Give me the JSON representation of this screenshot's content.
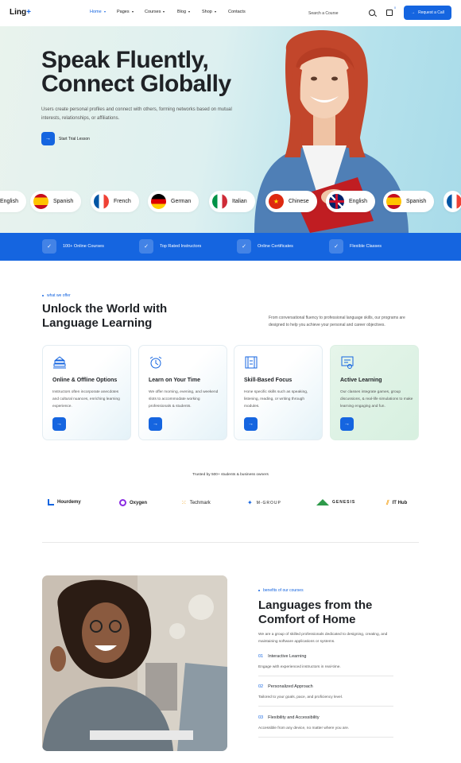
{
  "brand": {
    "name": "Ling",
    "plus": "+"
  },
  "nav": {
    "items": [
      {
        "label": "Home",
        "active": true,
        "dropdown": true
      },
      {
        "label": "Pages",
        "active": false,
        "dropdown": true
      },
      {
        "label": "Courses",
        "active": false,
        "dropdown": true
      },
      {
        "label": "Blog",
        "active": false,
        "dropdown": true
      },
      {
        "label": "Shop",
        "active": false,
        "dropdown": true
      },
      {
        "label": "Contacts",
        "active": false,
        "dropdown": false
      }
    ],
    "search_placeholder": "Search a Course",
    "cart_count": "0",
    "cta_label": "Request a Call"
  },
  "hero": {
    "title_line1": "Speak Fluently,",
    "title_line2": "Connect Globally",
    "description": "Users create personal profiles and connect with others, forming networks based on mutual interests, relationships, or affiliations.",
    "trial_label": "Start Trial Lesson"
  },
  "languages": [
    "English",
    "Spanish",
    "French",
    "German",
    "Italian",
    "Chinese",
    "English",
    "Spanish"
  ],
  "features": [
    "100+ Online Courses",
    "Top Rated Instructors",
    "Online Certificates",
    "Flexible Classes"
  ],
  "offer": {
    "tag": "what we offer",
    "title_line1": "Unlock the World with",
    "title_line2": "Language Learning",
    "lead": "From conversational fluency to professional language skills, our programs are designed to help you achieve your personal and career objectives.",
    "cards": [
      {
        "title": "Online & Offline Options",
        "text": "Instructors often incorporate anecdotes and cultural nuances, enriching learning experience.",
        "icon": "books-icon"
      },
      {
        "title": "Learn on Your Time",
        "text": "We offer morning, evening, and weekend slots to accommodate working professionals & students.",
        "icon": "alarm-clock-icon"
      },
      {
        "title": "Skill-Based Focus",
        "text": "Hone specific skills such as speaking, listening, reading, or writing through modules.",
        "icon": "film-strip-icon"
      },
      {
        "title": "Active Learning",
        "text": "Our classes integrate games, group discussions, & real-life simulations to make learning engaging and fun.",
        "icon": "certificate-icon"
      }
    ]
  },
  "trusted": {
    "label": "Trusted by 500+ students & business owners",
    "brands": [
      "Hourdemy",
      "Oxygen",
      "Techmark",
      "M-GROUP",
      "GENESIS",
      "IT Hub"
    ]
  },
  "benefits": {
    "tag": "benefits of our courses",
    "title_line1": "Languages from the",
    "title_line2": "Comfort of Home",
    "lead": "We are a group of skilled professionals dedicated to designing, creating, and maintaining software applications or systems.",
    "items": [
      {
        "num": "01",
        "title": "Interactive Learning",
        "text": "Engage with experienced instructors in real-time."
      },
      {
        "num": "02",
        "title": "Personalized Approach",
        "text": "Tailored to your goals, pace, and proficiency level."
      },
      {
        "num": "03",
        "title": "Flexibility and Accessibility",
        "text": "Accessible from any device, no matter where you are."
      }
    ]
  },
  "colors": {
    "accent": "#1565e0"
  }
}
